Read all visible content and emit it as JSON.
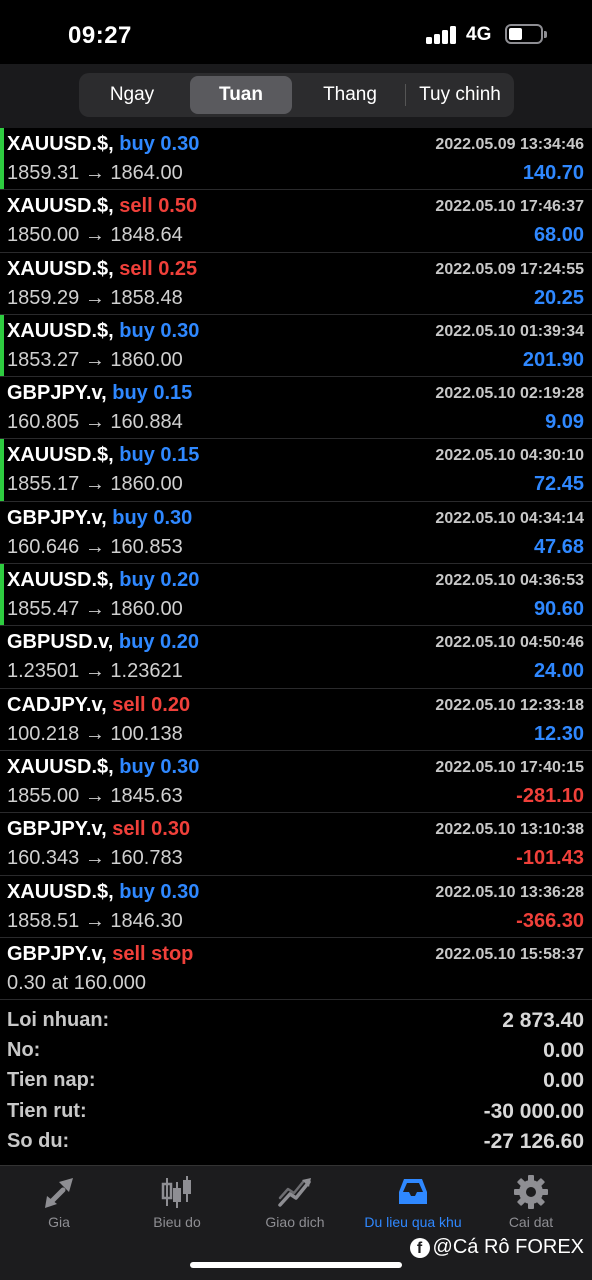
{
  "status_bar": {
    "time": "09:27",
    "network": "4G"
  },
  "period_tabs": [
    {
      "label": "Ngay",
      "active": false
    },
    {
      "label": "Tuan",
      "active": true
    },
    {
      "label": "Thang",
      "active": false
    },
    {
      "label": "Tuy chinh",
      "active": false
    }
  ],
  "trades": [
    {
      "symbol": "XAUUSD.$,",
      "side": "buy",
      "volume": "0.30",
      "prices": "1859.31 → 1864.00",
      "time": "2022.05.09 13:34:46",
      "profit": "140.70",
      "profit_sign": "pos",
      "accent": true
    },
    {
      "symbol": "XAUUSD.$,",
      "side": "sell",
      "volume": "0.50",
      "prices": "1850.00 → 1848.64",
      "time": "2022.05.10 17:46:37",
      "profit": "68.00",
      "profit_sign": "pos",
      "accent": false
    },
    {
      "symbol": "XAUUSD.$,",
      "side": "sell",
      "volume": "0.25",
      "prices": "1859.29 → 1858.48",
      "time": "2022.05.09 17:24:55",
      "profit": "20.25",
      "profit_sign": "pos",
      "accent": false
    },
    {
      "symbol": "XAUUSD.$,",
      "side": "buy",
      "volume": "0.30",
      "prices": "1853.27 → 1860.00",
      "time": "2022.05.10 01:39:34",
      "profit": "201.90",
      "profit_sign": "pos",
      "accent": true
    },
    {
      "symbol": "GBPJPY.v,",
      "side": "buy",
      "volume": "0.15",
      "prices": "160.805 → 160.884",
      "time": "2022.05.10 02:19:28",
      "profit": "9.09",
      "profit_sign": "pos",
      "accent": false
    },
    {
      "symbol": "XAUUSD.$,",
      "side": "buy",
      "volume": "0.15",
      "prices": "1855.17 → 1860.00",
      "time": "2022.05.10 04:30:10",
      "profit": "72.45",
      "profit_sign": "pos",
      "accent": true
    },
    {
      "symbol": "GBPJPY.v,",
      "side": "buy",
      "volume": "0.30",
      "prices": "160.646 → 160.853",
      "time": "2022.05.10 04:34:14",
      "profit": "47.68",
      "profit_sign": "pos",
      "accent": false
    },
    {
      "symbol": "XAUUSD.$,",
      "side": "buy",
      "volume": "0.20",
      "prices": "1855.47 → 1860.00",
      "time": "2022.05.10 04:36:53",
      "profit": "90.60",
      "profit_sign": "pos",
      "accent": true
    },
    {
      "symbol": "GBPUSD.v,",
      "side": "buy",
      "volume": "0.20",
      "prices": "1.23501 → 1.23621",
      "time": "2022.05.10 04:50:46",
      "profit": "24.00",
      "profit_sign": "pos",
      "accent": false
    },
    {
      "symbol": "CADJPY.v,",
      "side": "sell",
      "volume": "0.20",
      "prices": "100.218 → 100.138",
      "time": "2022.05.10 12:33:18",
      "profit": "12.30",
      "profit_sign": "pos",
      "accent": false
    },
    {
      "symbol": "XAUUSD.$,",
      "side": "buy",
      "volume": "0.30",
      "prices": "1855.00 → 1845.63",
      "time": "2022.05.10 17:40:15",
      "profit": "-281.10",
      "profit_sign": "neg",
      "accent": false
    },
    {
      "symbol": "GBPJPY.v,",
      "side": "sell",
      "volume": "0.30",
      "prices": "160.343 → 160.783",
      "time": "2022.05.10 13:10:38",
      "profit": "-101.43",
      "profit_sign": "neg",
      "accent": false
    },
    {
      "symbol": "XAUUSD.$,",
      "side": "buy",
      "volume": "0.30",
      "prices": "1858.51 → 1846.30",
      "time": "2022.05.10 13:36:28",
      "profit": "-366.30",
      "profit_sign": "neg",
      "accent": false
    },
    {
      "symbol": "GBPJPY.v,",
      "side": "sell",
      "volume": "stop",
      "prices": "0.30 at 160.000",
      "time": "2022.05.10 15:58:37",
      "profit": "",
      "profit_sign": "pos",
      "accent": false
    }
  ],
  "summary": [
    {
      "label": "Loi nhuan:",
      "value": "2 873.40"
    },
    {
      "label": "No:",
      "value": "0.00"
    },
    {
      "label": "Tien nap:",
      "value": "0.00"
    },
    {
      "label": "Tien rut:",
      "value": "-30 000.00"
    },
    {
      "label": "So du:",
      "value": "-27 126.60"
    }
  ],
  "tab_bar": [
    {
      "label": "Gia",
      "icon": "quotes-arrows-icon",
      "active": false
    },
    {
      "label": "Bieu do",
      "icon": "candlestick-chart-icon",
      "active": false
    },
    {
      "label": "Giao dich",
      "icon": "trade-trend-icon",
      "active": false
    },
    {
      "label": "Du lieu qua khu",
      "icon": "history-inbox-icon",
      "active": true
    },
    {
      "label": "Cai dat",
      "icon": "gear-icon",
      "active": false
    }
  ],
  "watermark": {
    "icon_letter": "f",
    "text": "@Cá Rô FOREX"
  },
  "colors": {
    "buy": "#2f88ff",
    "sell": "#f0403a",
    "accent": "#2ecc40",
    "active_tab": "#2f88ff"
  }
}
